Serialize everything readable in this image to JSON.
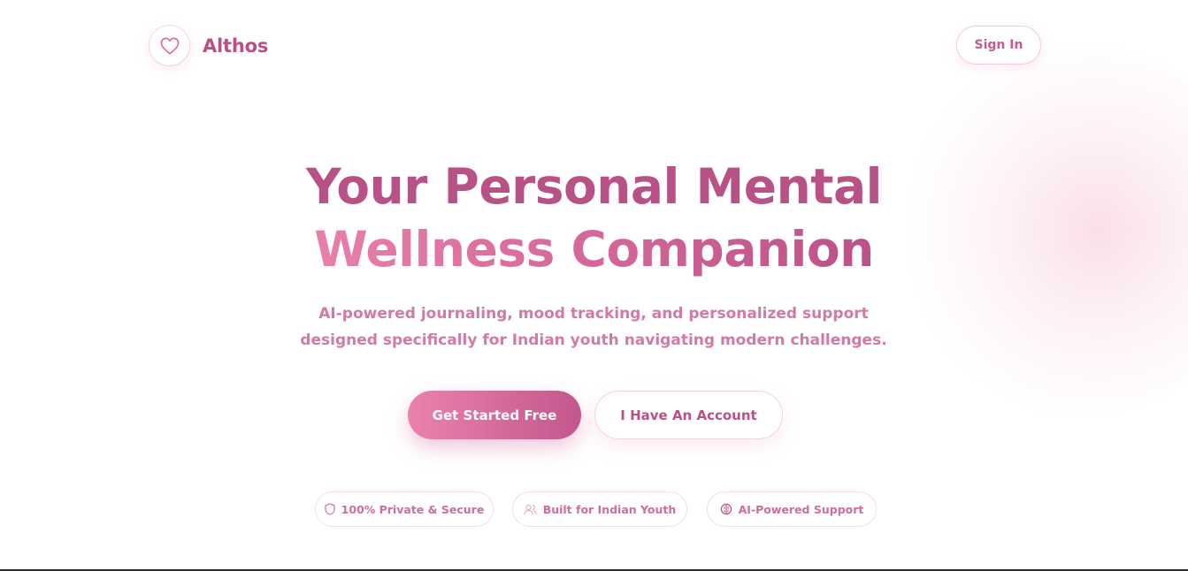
{
  "brand": {
    "name": "Althos",
    "icon": "heart-icon"
  },
  "nav": {
    "sign_in_label": "Sign In"
  },
  "hero": {
    "title_line1": "Your Personal Mental",
    "title_line2": "Wellness Companion",
    "subtitle_line1": "AI-powered journaling, mood tracking, and personalized support",
    "subtitle_line2": "designed specifically for Indian youth navigating modern challenges."
  },
  "cta": {
    "primary_label": "Get Started Free",
    "secondary_label": "I Have An Account"
  },
  "badges": [
    {
      "label": "100% Private & Secure",
      "icon": "shield-icon"
    },
    {
      "label": "Built for Indian Youth",
      "icon": "users-icon"
    },
    {
      "label": "AI-Powered Support",
      "icon": "brain-icon"
    }
  ],
  "colors": {
    "brand": "#b94f86",
    "accent_gradient_start": "#ea82ae",
    "accent_gradient_end": "#c2578c",
    "subtitle": "#d27aa6"
  }
}
